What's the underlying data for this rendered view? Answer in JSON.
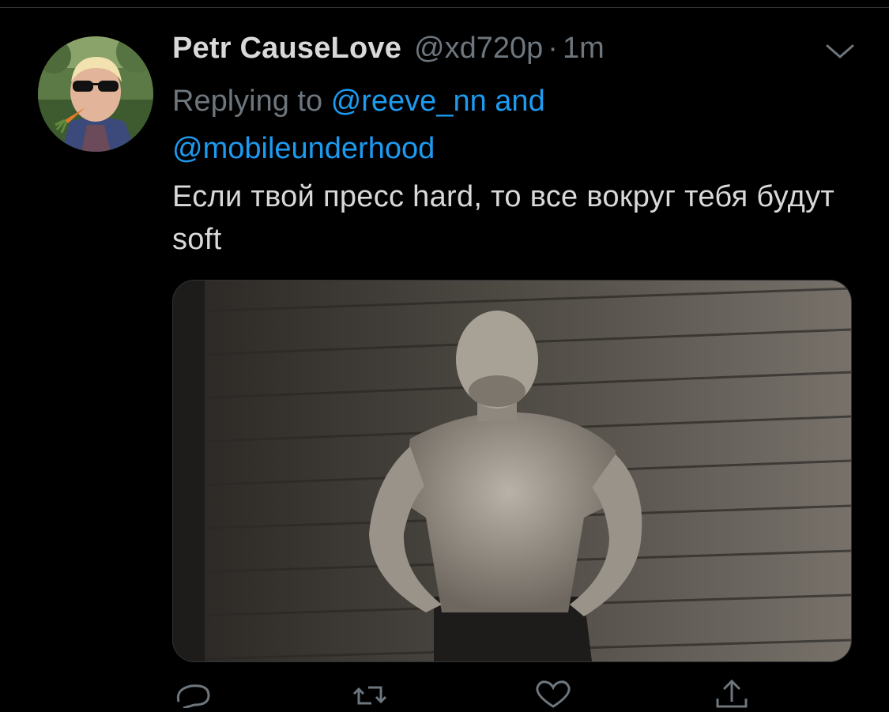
{
  "tweet": {
    "display_name": "Petr CauseLove",
    "handle": "@xd720p",
    "separator": "·",
    "time": "1m",
    "replying_prefix": "Replying to",
    "reply_mention_1": "@reeve_nn",
    "reply_and": "and",
    "reply_mention_2": "@mobileunderhood",
    "text": "Если твой пресс hard, то все вокруг тебя будут soft"
  },
  "colors": {
    "background": "#000000",
    "text": "#d9d9d9",
    "secondary": "#6e767d",
    "link": "#1d9bf0"
  },
  "icons": {
    "more": "chevron-down-icon",
    "reply": "comment-icon",
    "retweet": "retweet-icon",
    "like": "heart-icon",
    "share": "share-icon"
  }
}
